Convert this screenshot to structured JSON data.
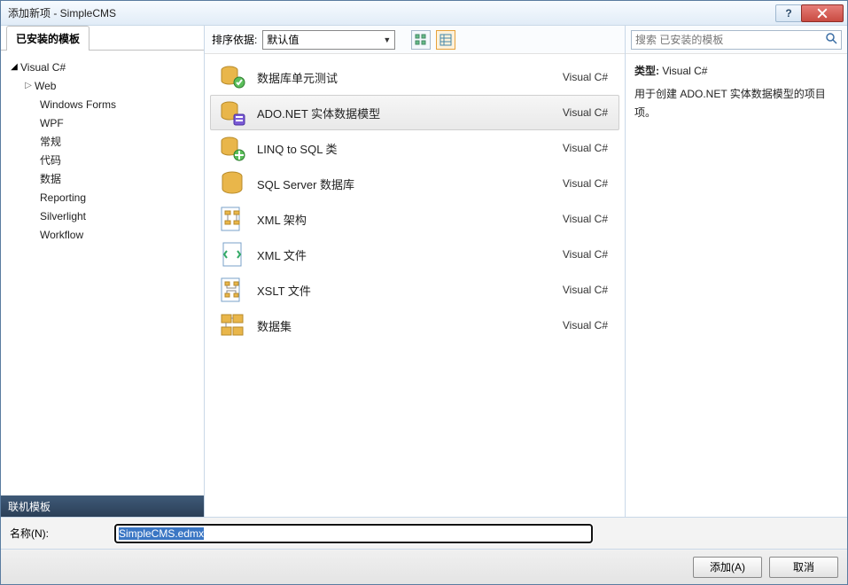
{
  "window": {
    "title": "添加新项 - SimpleCMS"
  },
  "sidebar": {
    "installed_tab": "已安装的模板",
    "root": "Visual C#",
    "children": [
      "Web",
      "Windows Forms",
      "WPF",
      "常规",
      "代码",
      "数据",
      "Reporting",
      "Silverlight",
      "Workflow"
    ],
    "online_header": "联机模板"
  },
  "toolbar": {
    "sort_label": "排序依据:",
    "sort_value": "默认值",
    "search_placeholder": "搜索 已安装的模板"
  },
  "items": [
    {
      "label": "数据库单元测试",
      "lang": "Visual C#",
      "icon": "db-test"
    },
    {
      "label": "ADO.NET 实体数据模型",
      "lang": "Visual C#",
      "icon": "db-model",
      "selected": true
    },
    {
      "label": "LINQ to SQL 类",
      "lang": "Visual C#",
      "icon": "db-linq"
    },
    {
      "label": "SQL Server 数据库",
      "lang": "Visual C#",
      "icon": "db-sql"
    },
    {
      "label": "XML 架构",
      "lang": "Visual C#",
      "icon": "xml-schema"
    },
    {
      "label": "XML 文件",
      "lang": "Visual C#",
      "icon": "xml-file"
    },
    {
      "label": "XSLT 文件",
      "lang": "Visual C#",
      "icon": "xslt-file"
    },
    {
      "label": "数据集",
      "lang": "Visual C#",
      "icon": "dataset"
    }
  ],
  "info": {
    "type_label": "类型:",
    "type_value": "Visual C#",
    "description": "用于创建 ADO.NET 实体数据模型的项目项。"
  },
  "footer": {
    "name_label": "名称(N):",
    "name_value": "SimpleCMS.edmx",
    "add_label": "添加(A)",
    "cancel_label": "取消"
  }
}
